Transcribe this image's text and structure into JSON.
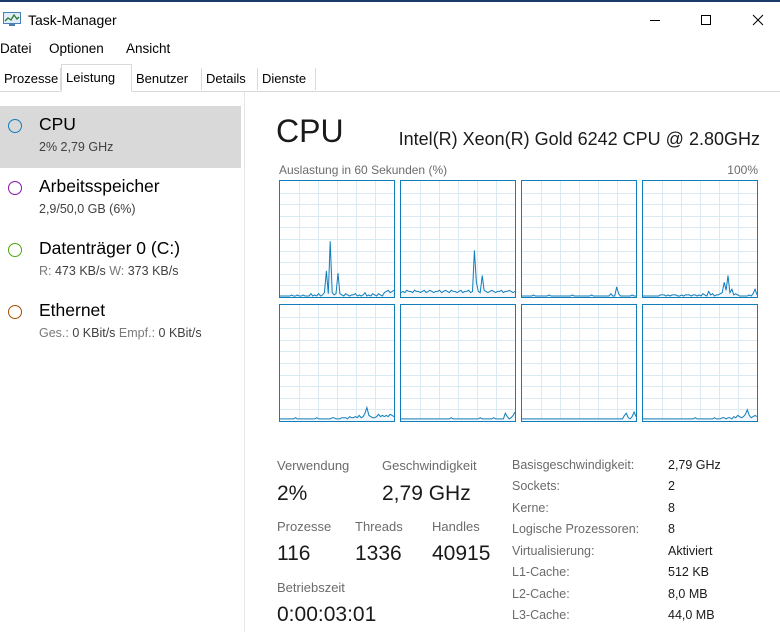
{
  "window": {
    "title": "Task-Manager"
  },
  "menu": [
    "Datei",
    "Optionen",
    "Ansicht"
  ],
  "tabs": [
    {
      "label": "Prozesse"
    },
    {
      "label": "Leistung"
    },
    {
      "label": "Benutzer"
    },
    {
      "label": "Details"
    },
    {
      "label": "Dienste"
    }
  ],
  "active_tab": "Leistung",
  "sidebar": [
    {
      "name": "CPU",
      "detail": "2% 2,79 GHz",
      "color": "#117dbb",
      "selected": true
    },
    {
      "name": "Arbeitsspeicher",
      "detail": "2,9/50,0 GB (6%)",
      "color": "#8b12ae"
    },
    {
      "name": "Datenträger 0 (C:)",
      "detail_parts": [
        {
          "label": "R:",
          "value": "473 KB/s"
        },
        {
          "label": "W:",
          "value": "373 KB/s"
        }
      ],
      "color": "#4da60c"
    },
    {
      "name": "Ethernet",
      "detail_parts": [
        {
          "label": "Ges.:",
          "value": "0 KBit/s"
        },
        {
          "label": "Empf.:",
          "value": "0 KBit/s"
        }
      ],
      "color": "#a74f01"
    }
  ],
  "main": {
    "title": "CPU",
    "cpu_model": "Intel(R) Xeon(R) Gold 6242 CPU @ 2.80GHz",
    "graph_label": "Auslastung in 60 Sekunden (%)",
    "graph_max": "100%",
    "graph_color": "#117dbb",
    "graph_grid_color": "#d9eaf4"
  },
  "chart_data": {
    "type": "area",
    "ylim": [
      0,
      100
    ],
    "series": [
      {
        "values": [
          0,
          0,
          0,
          0,
          0,
          0,
          1,
          0,
          0,
          1,
          0,
          0,
          1,
          0,
          0,
          0,
          2,
          0,
          1,
          0,
          2,
          0,
          1,
          3,
          22,
          2,
          48,
          3,
          1,
          2,
          20,
          2,
          1,
          0,
          2,
          1,
          0,
          1,
          1,
          2,
          0,
          1,
          0,
          1,
          3,
          0,
          1,
          0,
          2,
          1,
          0,
          2,
          1,
          0,
          3,
          4,
          5,
          3,
          4,
          5
        ]
      },
      {
        "values": [
          3,
          4,
          3,
          5,
          4,
          4,
          3,
          5,
          4,
          4,
          3,
          4,
          5,
          3,
          4,
          5,
          4,
          3,
          4,
          4,
          5,
          3,
          4,
          5,
          4,
          3,
          5,
          4,
          4,
          3,
          4,
          5,
          3,
          4,
          4,
          5,
          3,
          4,
          40,
          12,
          4,
          3,
          18,
          5,
          4,
          3,
          4,
          5,
          4,
          3,
          4,
          4,
          5,
          3,
          4,
          4,
          5,
          4,
          3,
          4
        ]
      },
      {
        "values": [
          0,
          0,
          0,
          0,
          0,
          0,
          1,
          0,
          0,
          0,
          0,
          0,
          0,
          0,
          1,
          0,
          0,
          0,
          0,
          0,
          0,
          0,
          0,
          0,
          0,
          0,
          1,
          0,
          0,
          0,
          0,
          0,
          0,
          0,
          0,
          0,
          1,
          0,
          0,
          0,
          0,
          0,
          0,
          0,
          0,
          0,
          2,
          0,
          0,
          8,
          2,
          0,
          0,
          0,
          0,
          0,
          0,
          1,
          0,
          0
        ]
      },
      {
        "values": [
          0,
          0,
          0,
          0,
          0,
          0,
          0,
          0,
          0,
          1,
          1,
          1,
          0,
          1,
          0,
          1,
          1,
          1,
          0,
          0,
          1,
          0,
          1,
          1,
          1,
          0,
          1,
          1,
          0,
          1,
          0,
          2,
          1,
          0,
          4,
          1,
          2,
          0,
          1,
          1,
          2,
          3,
          12,
          5,
          18,
          3,
          6,
          1,
          2,
          1,
          0,
          0,
          0,
          0,
          0,
          1,
          0,
          2,
          6,
          1
        ]
      },
      {
        "values": [
          1,
          1,
          1,
          1,
          1,
          1,
          1,
          1,
          2,
          1,
          1,
          1,
          1,
          1,
          1,
          1,
          1,
          1,
          1,
          2,
          1,
          1,
          1,
          1,
          1,
          1,
          1,
          2,
          2,
          1,
          1,
          1,
          2,
          2,
          2,
          1,
          3,
          2,
          2,
          3,
          2,
          4,
          2,
          3,
          6,
          11,
          4,
          3,
          2,
          2,
          3,
          5,
          3,
          4,
          3,
          4,
          3,
          5,
          4,
          3
        ]
      },
      {
        "values": [
          1,
          1,
          1,
          1,
          1,
          1,
          1,
          1,
          1,
          1,
          1,
          1,
          1,
          1,
          1,
          1,
          1,
          1,
          1,
          1,
          1,
          1,
          1,
          1,
          1,
          1,
          2,
          1,
          1,
          1,
          1,
          1,
          1,
          1,
          1,
          1,
          1,
          1,
          1,
          1,
          1,
          2,
          1,
          1,
          1,
          1,
          1,
          1,
          2,
          1,
          1,
          1,
          1,
          1,
          6,
          3,
          1,
          2,
          4,
          7
        ]
      },
      {
        "values": [
          1,
          1,
          1,
          1,
          1,
          1,
          1,
          1,
          1,
          1,
          1,
          1,
          1,
          1,
          1,
          1,
          1,
          1,
          1,
          1,
          1,
          1,
          1,
          1,
          1,
          1,
          1,
          1,
          1,
          1,
          1,
          1,
          1,
          1,
          1,
          1,
          1,
          1,
          1,
          1,
          1,
          1,
          1,
          1,
          1,
          1,
          1,
          1,
          1,
          1,
          1,
          1,
          1,
          4,
          6,
          2,
          1,
          3,
          7,
          3
        ]
      },
      {
        "values": [
          1,
          1,
          1,
          1,
          1,
          1,
          1,
          1,
          1,
          1,
          1,
          1,
          1,
          1,
          1,
          1,
          1,
          1,
          1,
          1,
          1,
          1,
          1,
          1,
          1,
          1,
          1,
          2,
          1,
          1,
          1,
          1,
          1,
          1,
          1,
          1,
          1,
          2,
          1,
          1,
          1,
          2,
          2,
          1,
          2,
          2,
          1,
          3,
          2,
          4,
          3,
          2,
          3,
          5,
          9,
          4,
          2,
          3,
          4,
          3
        ]
      }
    ]
  },
  "stats": {
    "usage_label": "Verwendung",
    "usage_value": "2%",
    "speed_label": "Geschwindigkeit",
    "speed_value": "2,79 GHz",
    "processes_label": "Prozesse",
    "processes_value": "116",
    "threads_label": "Threads",
    "threads_value": "1336",
    "handles_label": "Handles",
    "handles_value": "40915",
    "uptime_label": "Betriebszeit",
    "uptime_value": "0:00:03:01"
  },
  "info": [
    {
      "label": "Basisgeschwindigkeit:",
      "value": "2,79 GHz"
    },
    {
      "label": "Sockets:",
      "value": "2"
    },
    {
      "label": "Kerne:",
      "value": "8"
    },
    {
      "label": "Logische Prozessoren:",
      "value": "8"
    },
    {
      "label": "Virtualisierung:",
      "value": "Aktiviert"
    },
    {
      "label": "L1-Cache:",
      "value": "512 KB"
    },
    {
      "label": "L2-Cache:",
      "value": "8,0 MB"
    },
    {
      "label": "L3-Cache:",
      "value": "44,0 MB"
    }
  ]
}
